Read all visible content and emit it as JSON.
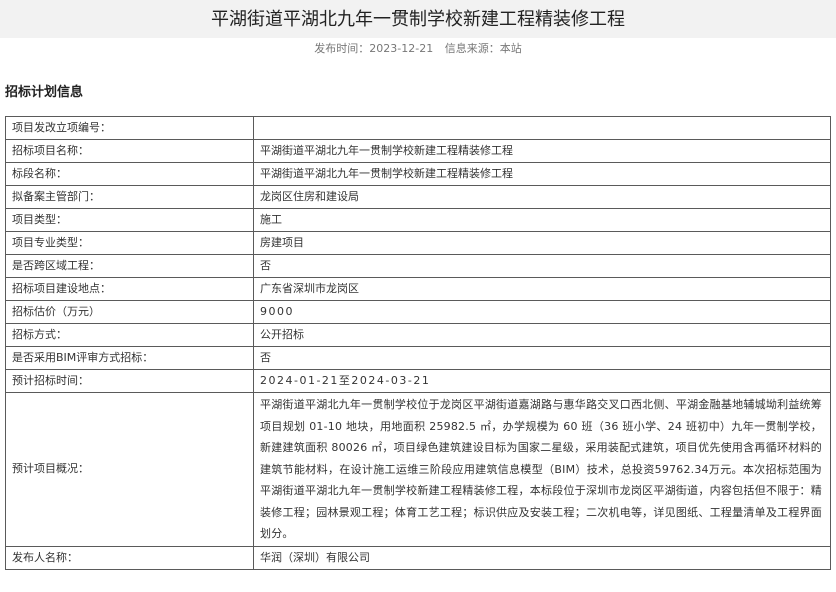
{
  "page": {
    "title": "平湖街道平湖北九年一贯制学校新建工程精装修工程",
    "publish_time": "发布时间：2023-12-21",
    "source": "信息来源：本站"
  },
  "section_title": "招标计划信息",
  "rows": [
    {
      "label": "项目发改立项编号：",
      "value": ""
    },
    {
      "label": "招标项目名称：",
      "value": "平湖街道平湖北九年一贯制学校新建工程精装修工程"
    },
    {
      "label": "标段名称：",
      "value": "平湖街道平湖北九年一贯制学校新建工程精装修工程"
    },
    {
      "label": "拟备案主管部门：",
      "value": "龙岗区住房和建设局"
    },
    {
      "label": "项目类型：",
      "value": "施工"
    },
    {
      "label": "项目专业类型：",
      "value": "房建项目"
    },
    {
      "label": "是否跨区域工程：",
      "value": "否"
    },
    {
      "label": "招标项目建设地点：",
      "value": "广东省深圳市龙岗区"
    },
    {
      "label": "招标估价（万元）",
      "value": "9000"
    },
    {
      "label": "招标方式：",
      "value": "公开招标"
    },
    {
      "label": "是否采用BIM评审方式招标：",
      "value": "否"
    },
    {
      "label": "预计招标时间：",
      "value": "2024-01-21至2024-03-21"
    },
    {
      "label": "预计项目概况：",
      "value": "平湖街道平湖北九年一贯制学校位于龙岗区平湖街道嘉湖路与惠华路交叉口西北侧、平湖金融基地辅城坳利益统筹项目规划 01-10 地块，用地面积 25982.5 ㎡，办学规模为 60 班（36 班小学、24 班初中）九年一贯制学校，新建建筑面积 80026 ㎡，项目绿色建筑建设目标为国家二星级，采用装配式建筑，项目优先使用含再循环材料的建筑节能材料，在设计施工运维三阶段应用建筑信息模型（BIM）技术，总投资59762.34万元。本次招标范围为平湖街道平湖北九年一贯制学校新建工程精装修工程，本标段位于深圳市龙岗区平湖街道，内容包括但不限于：精装修工程；园林景观工程；体育工艺工程；标识供应及安装工程；二次机电等，详见图纸、工程量清单及工程界面划分。"
    },
    {
      "label": "发布人名称：",
      "value": "华润（深圳）有限公司"
    }
  ]
}
